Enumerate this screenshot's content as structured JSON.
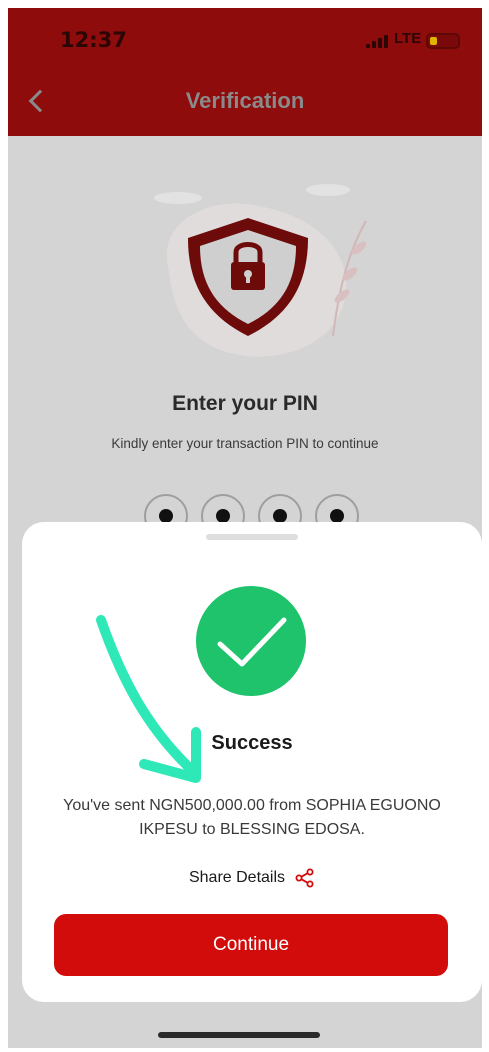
{
  "status_bar": {
    "time": "12:37",
    "network": "LTE"
  },
  "header": {
    "title": "Verification"
  },
  "pin_screen": {
    "title": "Enter your PIN",
    "subtitle": "Kindly enter your transaction PIN to continue",
    "digits_entered": 4
  },
  "success_sheet": {
    "title": "Success",
    "message": "You've sent NGN500,000.00 from SOPHIA EGUONO IKPESU to BLESSING EDOSA.",
    "share_label": "Share Details",
    "continue_label": "Continue"
  },
  "colors": {
    "brand_red": "#d20b0b",
    "header_dimmed": "#8f0c0c",
    "success_green": "#1fc36b",
    "annotation_arrow": "#2ee8b8"
  },
  "icons": [
    "back-chevron-icon",
    "shield-lock-icon",
    "checkmark-icon",
    "share-icon",
    "signal-icon",
    "battery-icon"
  ]
}
